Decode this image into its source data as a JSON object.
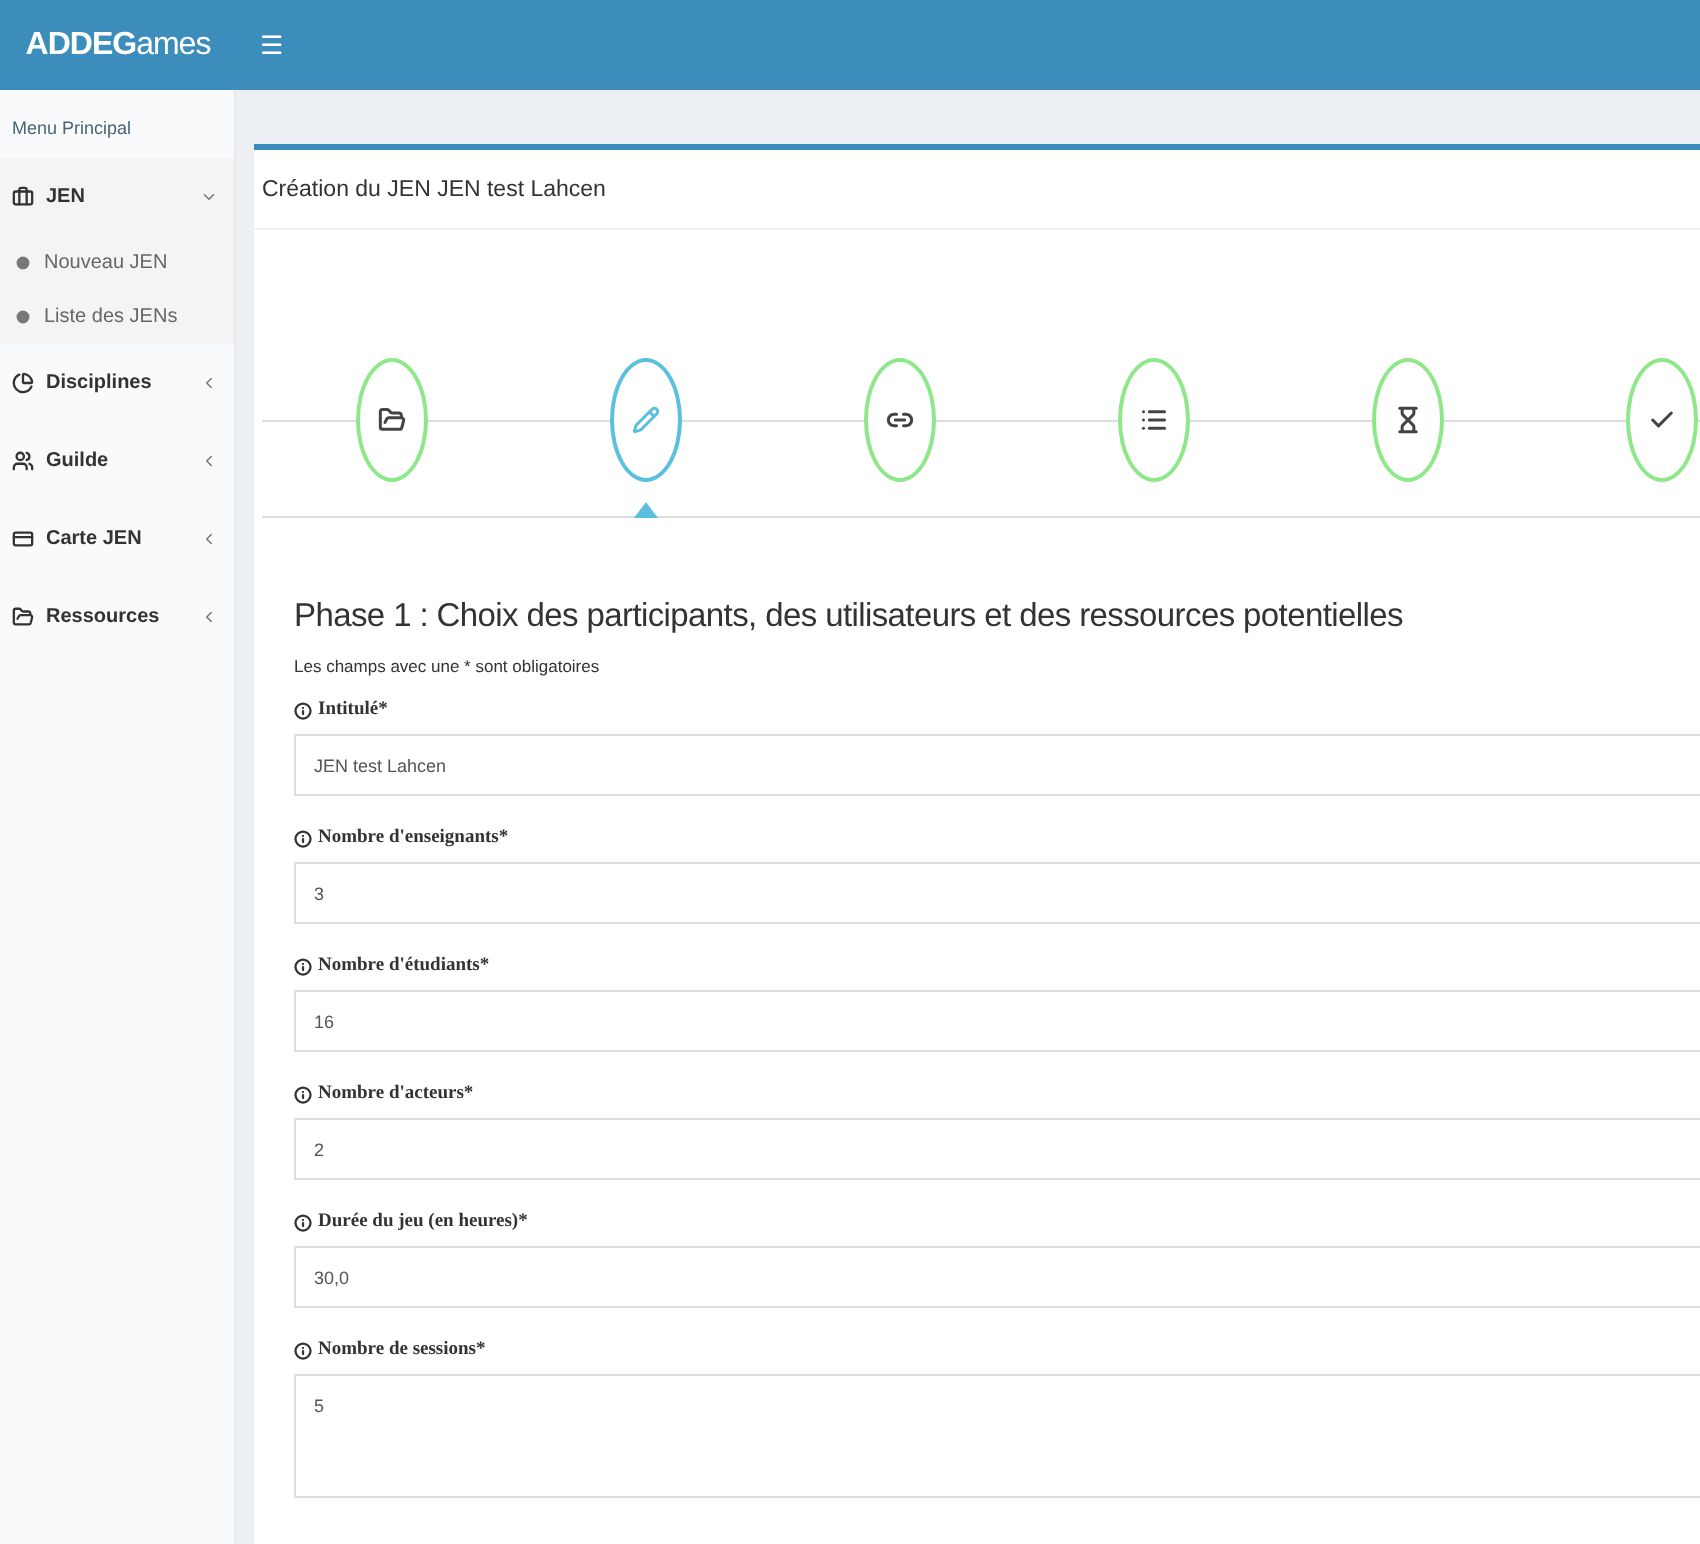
{
  "header": {
    "logo_bold": "ADDEG",
    "logo_rest": "ames",
    "menu_toggle": "☰"
  },
  "sidebar": {
    "heading": "Menu Principal",
    "items": [
      {
        "label": "JEN",
        "expanded": true,
        "children": [
          {
            "label": "Nouveau JEN"
          },
          {
            "label": "Liste des JENs"
          }
        ]
      },
      {
        "label": "Disciplines",
        "expanded": false
      },
      {
        "label": "Guilde",
        "expanded": false
      },
      {
        "label": "Carte JEN",
        "expanded": false
      },
      {
        "label": "Ressources",
        "expanded": false
      }
    ]
  },
  "panel": {
    "title": "Création du JEN JEN test Lahcen",
    "steps": [
      {
        "selected": false
      },
      {
        "selected": true
      },
      {
        "selected": false
      },
      {
        "selected": false
      },
      {
        "selected": false
      },
      {
        "selected": false
      }
    ],
    "form_title": "Phase 1 : Choix des participants, des utilisateurs et des ressources potentielles",
    "note": "Les champs avec une * sont obligatoires",
    "fields": [
      {
        "label": "Intitulé*",
        "value": "JEN test Lahcen",
        "kind": "input"
      },
      {
        "label": "Nombre d'enseignants*",
        "value": "3",
        "kind": "input"
      },
      {
        "label": "Nombre d'étudiants*",
        "value": "16",
        "kind": "input"
      },
      {
        "label": "Nombre d'acteurs*",
        "value": "2",
        "kind": "input"
      },
      {
        "label": "Durée du jeu (en heures)*",
        "value": "30,0",
        "kind": "input"
      },
      {
        "label": "Nombre de sessions*",
        "value": "5",
        "kind": "textarea"
      }
    ]
  }
}
